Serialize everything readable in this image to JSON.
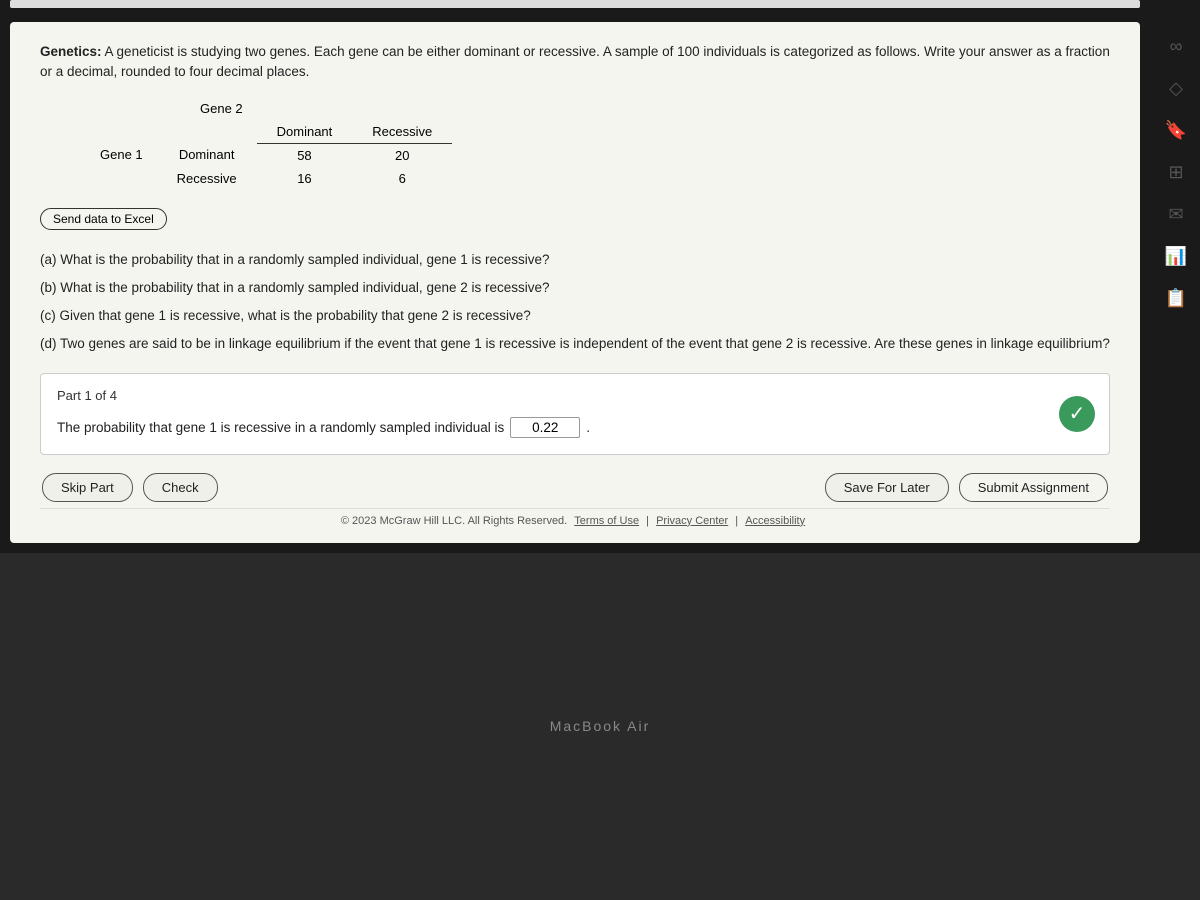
{
  "problem": {
    "header_bold": "Genetics:",
    "header_text": " A geneticist is studying two genes. Each gene can be either dominant or recessive. A sample of 100 individuals is categorized as follows. Write your answer as a fraction or a decimal, rounded to four decimal places.",
    "gene2_label": "Gene 2",
    "gene1_label": "Gene 1",
    "table": {
      "col_headers": [
        "Dominant",
        "Recessive"
      ],
      "rows": [
        {
          "label": "Dominant",
          "values": [
            "58",
            "20"
          ]
        },
        {
          "label": "Recessive",
          "values": [
            "16",
            "6"
          ]
        }
      ]
    },
    "send_data_btn": "Send data to Excel",
    "questions": [
      "(a) What is the probability that in a randomly sampled individual, gene 1 is recessive?",
      "(b) What is the probability that in a randomly sampled individual, gene 2 is recessive?",
      "(c) Given that gene 1 is recessive, what is the probability that gene 2 is recessive?",
      "(d) Two genes are said to be in linkage equilibrium if the event that gene 1 is recessive is independent of the event that gene 2 is recessive. Are these genes in linkage equilibrium?"
    ]
  },
  "part_box": {
    "part_label": "Part 1 of 4",
    "answer_text_before": "The probability that gene 1 is recessive in a randomly sampled individual is",
    "answer_value": "0.22",
    "answer_text_after": "."
  },
  "actions": {
    "skip_part": "Skip Part",
    "check": "Check",
    "save_for_later": "Save For Later",
    "submit_assignment": "Submit Assignment"
  },
  "footer": {
    "copyright": "© 2023 McGraw Hill LLC. All Rights Reserved.",
    "terms": "Terms of Use",
    "privacy": "Privacy Center",
    "accessibility": "Accessibility"
  },
  "sidebar": {
    "icons": [
      "∞",
      "◇",
      "⬚",
      "⊞",
      "✉",
      "dlo",
      "⊡"
    ]
  },
  "keyboard_label": "MacBook Air"
}
